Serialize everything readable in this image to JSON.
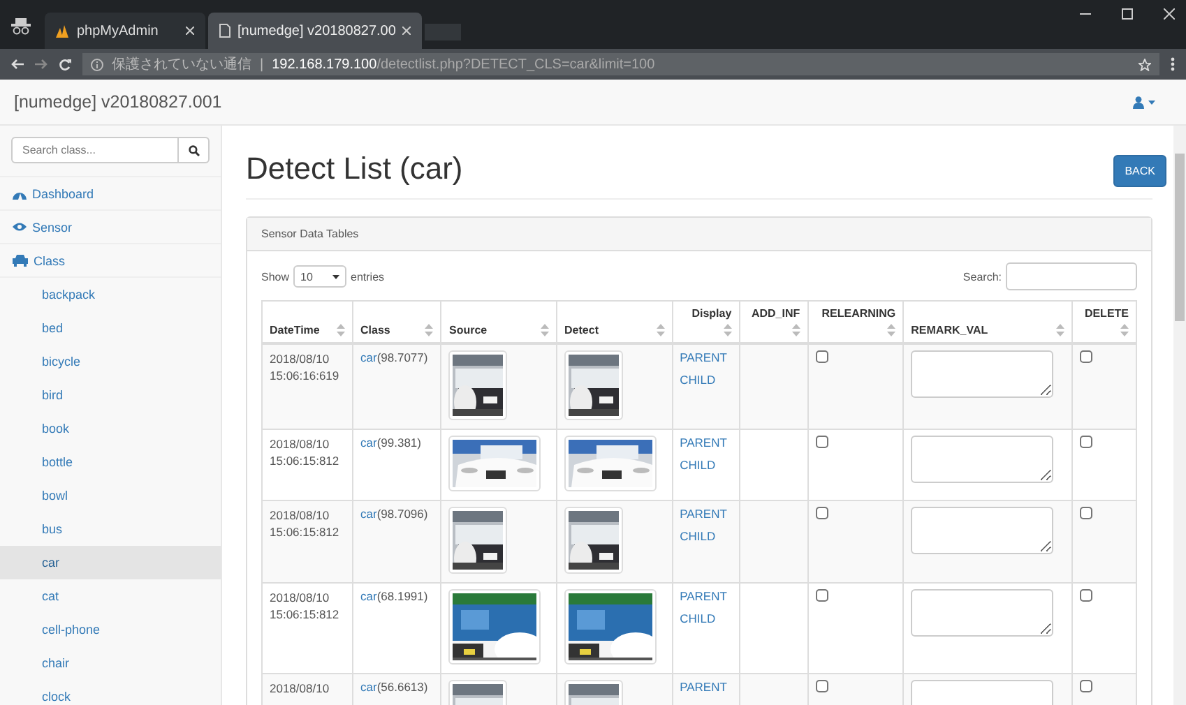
{
  "browser": {
    "tabs": [
      {
        "title": "phpMyAdmin",
        "selected": false
      },
      {
        "title": "[numedge] v20180827.00",
        "selected": true
      }
    ],
    "security_label": "保護されていない通信",
    "separator": "|",
    "url_host": "192.168.179.100",
    "url_path": "/detectlist.php?DETECT_CLS=car&limit=100"
  },
  "navbar": {
    "brand": "[numedge] v20180827.001"
  },
  "sidebar": {
    "search": {
      "placeholder": "Search class..."
    },
    "items": [
      {
        "label": "Dashboard"
      },
      {
        "label": "Sensor"
      },
      {
        "label": "Class",
        "children": [
          {
            "label": "backpack",
            "selected": false
          },
          {
            "label": "bed",
            "selected": false
          },
          {
            "label": "bicycle",
            "selected": false
          },
          {
            "label": "bird",
            "selected": false
          },
          {
            "label": "book",
            "selected": false
          },
          {
            "label": "bottle",
            "selected": false
          },
          {
            "label": "bowl",
            "selected": false
          },
          {
            "label": "bus",
            "selected": false
          },
          {
            "label": "car",
            "selected": true
          },
          {
            "label": "cat",
            "selected": false
          },
          {
            "label": "cell-phone",
            "selected": false
          },
          {
            "label": "chair",
            "selected": false
          },
          {
            "label": "clock",
            "selected": false
          }
        ]
      }
    ]
  },
  "page": {
    "title": "Detect List (car)",
    "back_button": "BACK"
  },
  "panel": {
    "heading": "Sensor Data Tables",
    "length_label_before": "Show",
    "length_value": "10",
    "length_label_after": "entries",
    "search_label": "Search:"
  },
  "table": {
    "columns": [
      "DateTime",
      "Class",
      "Source",
      "Detect",
      "Display",
      "ADD_INF",
      "RELEARNING",
      "REMARK_VAL",
      "DELETE"
    ],
    "rows": [
      {
        "date": "2018/08/10",
        "time": "15:06:16:619",
        "class_link": "car",
        "score": "(98.7077)",
        "links": [
          "PARENT",
          "CHILD"
        ],
        "relearning": false,
        "delete": false
      },
      {
        "date": "2018/08/10",
        "time": "15:06:15:812",
        "class_link": "car",
        "score": "(99.381)",
        "links": [
          "PARENT",
          "CHILD"
        ],
        "relearning": false,
        "delete": false
      },
      {
        "date": "2018/08/10",
        "time": "15:06:15:812",
        "class_link": "car",
        "score": "(98.7096)",
        "links": [
          "PARENT",
          "CHILD"
        ],
        "relearning": false,
        "delete": false
      },
      {
        "date": "2018/08/10",
        "time": "15:06:15:812",
        "class_link": "car",
        "score": "(68.1991)",
        "links": [
          "PARENT",
          "CHILD"
        ],
        "relearning": false,
        "delete": false
      },
      {
        "date": "2018/08/10",
        "class_link": "car",
        "score": "(56.6613)",
        "links": [
          "PARENT"
        ],
        "relearning": false,
        "delete": false
      }
    ]
  }
}
